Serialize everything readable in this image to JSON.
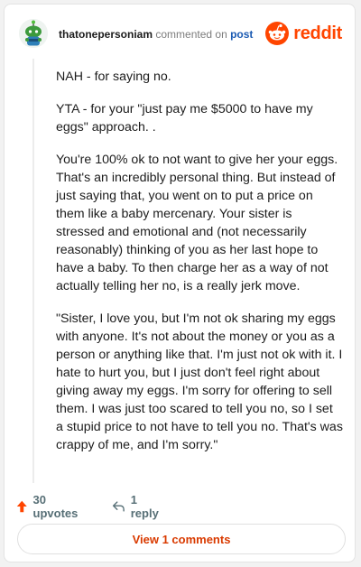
{
  "header": {
    "username": "thatonepersoniam",
    "commented_on": "commented on",
    "post_link": "post",
    "brand": "reddit",
    "icons": {
      "avatar": "snoo-avatar",
      "logo": "reddit-snoo-icon"
    }
  },
  "comment": {
    "paragraphs": [
      "NAH - for saying no.",
      "YTA - for your \"just pay me $5000 to have my eggs\" approach. .",
      "You're 100% ok to not want to give her your eggs. That's an incredibly personal thing. But instead of just saying that, you went on to put a price on them like a baby mercenary. Your sister is stressed and emotional and (not necessarily reasonably) thinking of you as her last hope to have a baby. To then charge her as a way of not actually telling her no, is a really jerk move.",
      "\"Sister, I love you, but I'm not ok sharing my eggs with anyone. It's not about the money or you as a person or anything like that. I'm just not ok with it. I hate to hurt you, but I just don't feel right about giving away my eggs. I'm sorry for offering to sell them. I was just too scared to tell you no, so I set a stupid price to not have to tell you no. That's was crappy of me, and I'm sorry.\""
    ]
  },
  "actions": {
    "upvotes": "30 upvotes",
    "replies": "1 reply",
    "icons": {
      "upvote": "upvote-arrow-icon",
      "reply": "reply-arrow-icon"
    }
  },
  "footer": {
    "view_comments": "View 1 comments"
  },
  "colors": {
    "accent": "#ff4500",
    "link": "#1a5ab2",
    "muted": "#576f76",
    "view_text": "#d93a00"
  }
}
